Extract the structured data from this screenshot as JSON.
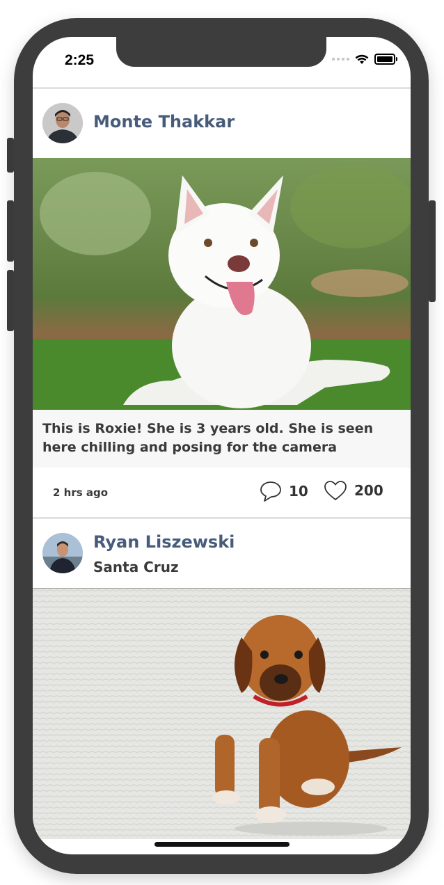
{
  "status_bar": {
    "time": "2:25"
  },
  "posts": [
    {
      "author": "Monte Thakkar",
      "location": "",
      "caption": "This is Roxie! She is 3 years old. She is seen here chilling and posing for the camera",
      "timestamp": "2 hrs ago",
      "comments": "10",
      "likes": "200"
    },
    {
      "author": "Ryan Liszewski",
      "location": "Santa Cruz"
    }
  ],
  "colors": {
    "author": "#475c7a",
    "caption_bg": "#f7f7f7",
    "frame": "#3d3d3d"
  }
}
